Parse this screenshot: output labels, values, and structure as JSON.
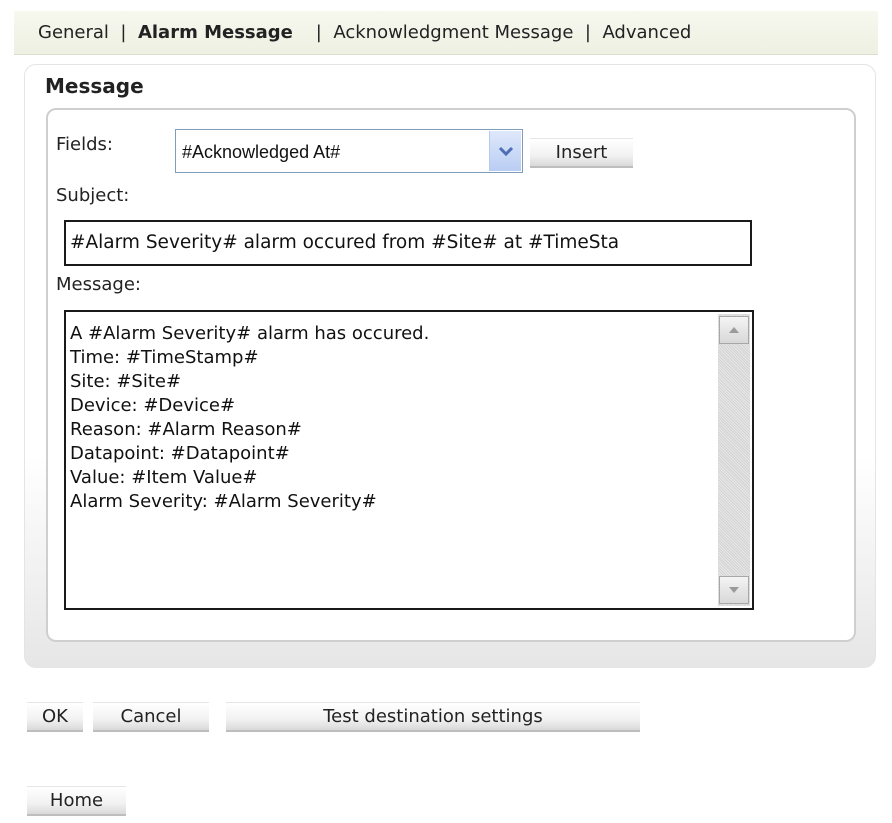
{
  "tabs": {
    "general": "General",
    "alarm_message": "Alarm Message",
    "ack_message": "Acknowledgment Message",
    "advanced": "Advanced",
    "separator": "|"
  },
  "section_title": "Message",
  "fields": {
    "label": "Fields:",
    "selected": "#Acknowledged At#",
    "insert_label": "Insert"
  },
  "subject": {
    "label": "Subject:",
    "value": "#Alarm Severity# alarm occured from #Site# at #TimeSta"
  },
  "message": {
    "label": "Message:",
    "value": "A #Alarm Severity# alarm has occured.\nTime: #TimeStamp#\nSite: #Site#\nDevice: #Device#\nReason: #Alarm Reason#\nDatapoint: #Datapoint#\nValue: #Item Value#\nAlarm Severity: #Alarm Severity#"
  },
  "buttons": {
    "ok": "OK",
    "cancel": "Cancel",
    "test": "Test destination settings",
    "home": "Home"
  },
  "icons": {
    "dropdown": "chevron-down-icon",
    "scroll_up": "arrow-up-icon",
    "scroll_down": "arrow-down-icon"
  },
  "colors": {
    "tabbar_bg": "#f3f4e8",
    "dropdown_arrow": "#4d6fb5"
  }
}
